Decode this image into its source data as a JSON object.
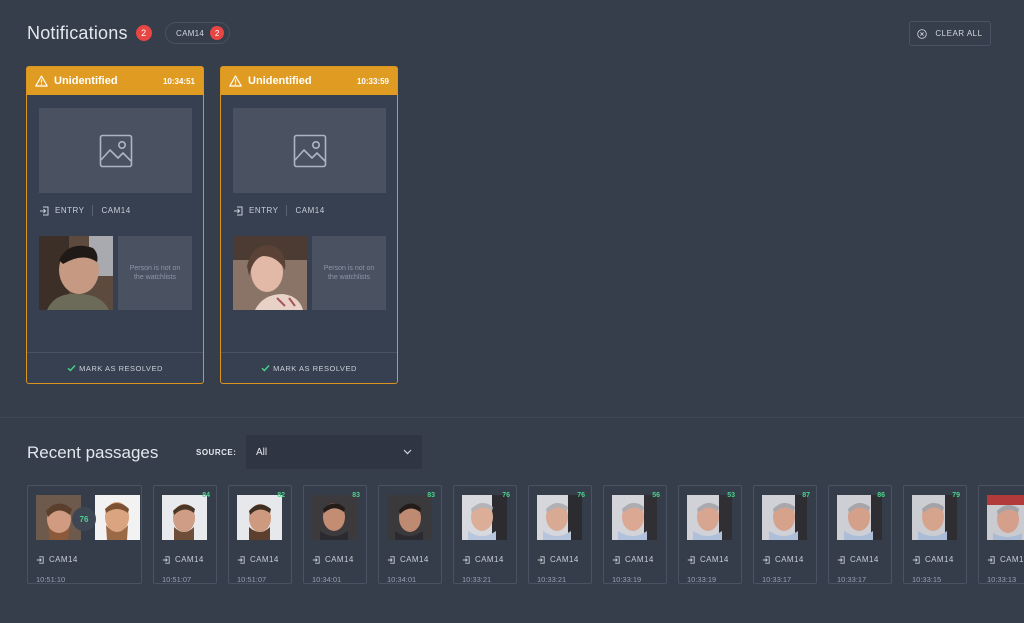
{
  "notifications": {
    "title": "Notifications",
    "count": "2",
    "camera_filter": {
      "label": "CAM14",
      "count": "2"
    },
    "clear_all_label": "CLEAR ALL",
    "cards": [
      {
        "status": "Unidentified",
        "time": "10:34:51",
        "direction": "ENTRY",
        "camera": "CAM14",
        "note": "Person is not on the watchlists",
        "resolve_label": "MARK AS RESOLVED"
      },
      {
        "status": "Unidentified",
        "time": "10:33:59",
        "direction": "ENTRY",
        "camera": "CAM14",
        "note": "Person is not on the watchlists",
        "resolve_label": "MARK AS RESOLVED"
      }
    ]
  },
  "recent": {
    "title": "Recent passages",
    "source_label": "SOURCE:",
    "source_value": "All",
    "items": [
      {
        "camera": "CAM14",
        "time": "10:51:10",
        "score": "76"
      },
      {
        "camera": "CAM14",
        "time": "10:51:07",
        "score": "84"
      },
      {
        "camera": "CAM14",
        "time": "10:51:07",
        "score": "82"
      },
      {
        "camera": "CAM14",
        "time": "10:34:01",
        "score": "83"
      },
      {
        "camera": "CAM14",
        "time": "10:34:01",
        "score": "83"
      },
      {
        "camera": "CAM14",
        "time": "10:33:21",
        "score": "76"
      },
      {
        "camera": "CAM14",
        "time": "10:33:21",
        "score": "76"
      },
      {
        "camera": "CAM14",
        "time": "10:33:19",
        "score": "56"
      },
      {
        "camera": "CAM14",
        "time": "10:33:19",
        "score": "53"
      },
      {
        "camera": "CAM14",
        "time": "10:33:17",
        "score": "87"
      },
      {
        "camera": "CAM14",
        "time": "10:33:17",
        "score": "86"
      },
      {
        "camera": "CAM14",
        "time": "10:33:15",
        "score": "79"
      },
      {
        "camera": "CAM1",
        "time": "10:33:13",
        "score": ""
      }
    ]
  },
  "colors": {
    "background": "#363d4b",
    "alert": "#e09b23",
    "badge": "#e84545",
    "score": "#4ad28a"
  }
}
